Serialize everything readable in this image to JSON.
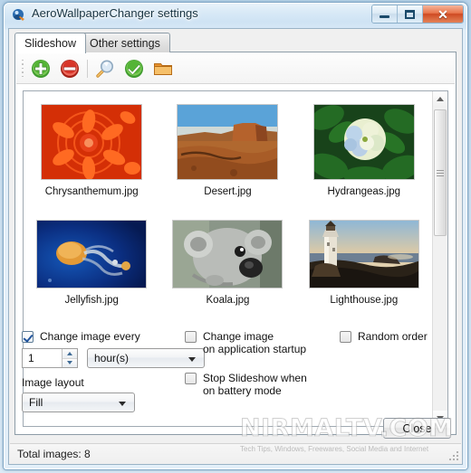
{
  "window": {
    "title": "AeroWallpaperChanger settings",
    "icon": "app-icon",
    "buttons": {
      "minimize": "minimize-button",
      "maximize": "maximize-button",
      "close": "close-button",
      "close_glyph": "✕"
    }
  },
  "tabs": [
    {
      "label": "Slideshow",
      "active": true
    },
    {
      "label": "Other settings",
      "active": false
    }
  ],
  "toolbar": {
    "items": [
      {
        "name": "add-image-button",
        "icon": "green-plus-icon"
      },
      {
        "name": "remove-image-button",
        "icon": "red-minus-icon"
      },
      {
        "name": "preview-button",
        "icon": "magnifier-icon"
      },
      {
        "name": "apply-button",
        "icon": "green-check-icon"
      },
      {
        "name": "open-folder-button",
        "icon": "folder-icon"
      }
    ]
  },
  "images": [
    {
      "name": "Chrysanthemum.jpg",
      "thumb": "chrysanthemum"
    },
    {
      "name": "Desert.jpg",
      "thumb": "desert"
    },
    {
      "name": "Hydrangeas.jpg",
      "thumb": "hydrangeas"
    },
    {
      "name": "Jellyfish.jpg",
      "thumb": "jellyfish"
    },
    {
      "name": "Koala.jpg",
      "thumb": "koala"
    },
    {
      "name": "Lighthouse.jpg",
      "thumb": "lighthouse"
    }
  ],
  "options": {
    "change_image_every": {
      "label": "Change image every",
      "checked": true
    },
    "interval_value": "1",
    "interval_unit": "hour(s)",
    "image_layout_label": "Image layout",
    "image_layout_value": "Fill",
    "change_on_startup": {
      "label_line1": "Change image",
      "label_line2": "on application startup",
      "checked": false
    },
    "stop_on_battery": {
      "label_line1": "Stop Slideshow when",
      "label_line2": "on battery mode",
      "checked": false
    },
    "random_order": {
      "label": "Random order",
      "checked": false
    }
  },
  "footer": {
    "close_label": "Close",
    "status": "Total images: 8"
  },
  "watermark": {
    "main": "NIRMALTV.COM",
    "sub": "Tech Tips, Windows, Freewares, Social Media and Internet"
  },
  "colors": {
    "accent": "#21549c",
    "close_red": "#cf4a22",
    "tab_active_bg": "#ffffff"
  }
}
